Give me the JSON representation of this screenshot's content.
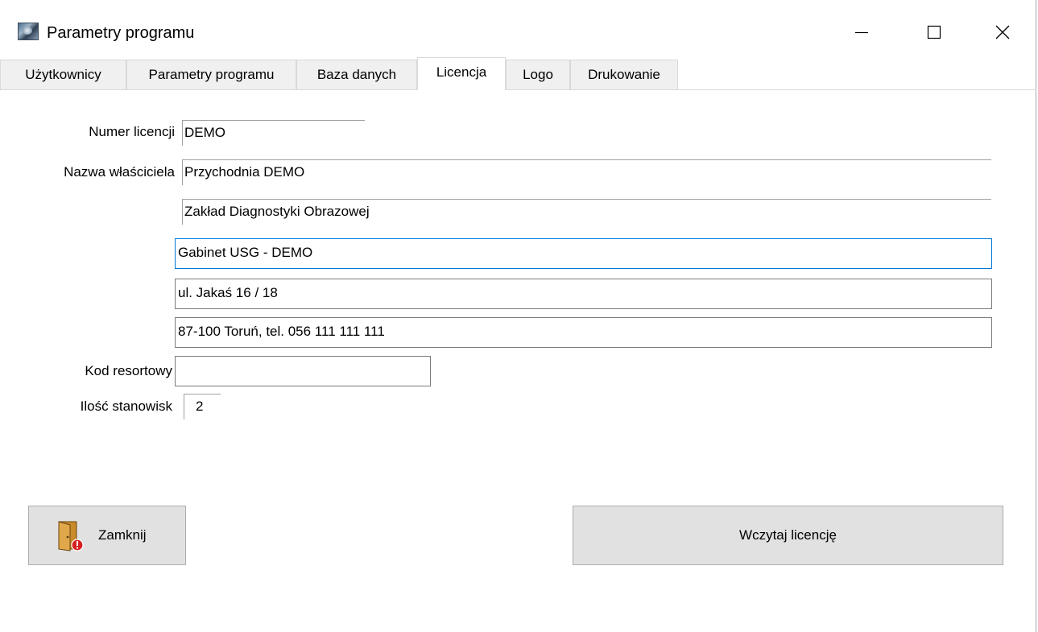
{
  "window": {
    "title": "Parametry programu"
  },
  "tabs": [
    {
      "label": "Użytkownicy"
    },
    {
      "label": "Parametry programu"
    },
    {
      "label": "Baza danych"
    },
    {
      "label": "Licencja",
      "active": true
    },
    {
      "label": "Logo"
    },
    {
      "label": "Drukowanie"
    }
  ],
  "license": {
    "license_number_label": "Numer licencji",
    "license_number": "DEMO",
    "owner_name_label": "Nazwa właściciela",
    "owner_line_1": "Przychodnia DEMO",
    "owner_line_2": "Zakład Diagnostyki Obrazowej",
    "owner_line_3": "Gabinet USG - DEMO",
    "owner_line_4": "ul. Jakaś 16 / 18",
    "owner_line_5": "87-100 Toruń, tel. 056 111 111 111",
    "department_code_label": "Kod resortowy",
    "department_code": "",
    "workstations_label": "Ilość stanowisk",
    "workstations": "2"
  },
  "buttons": {
    "close_label": "Zamknij",
    "load_license_label": "Wczytaj licencję"
  },
  "icons": {
    "app": "app-icon",
    "minimize": "minimize-icon",
    "maximize": "maximize-icon",
    "close": "close-icon",
    "door": "door-exit-icon"
  },
  "colors": {
    "focus_border": "#0078d7",
    "button_face": "#e1e1e1",
    "tab_inactive": "#f0f0f0"
  }
}
